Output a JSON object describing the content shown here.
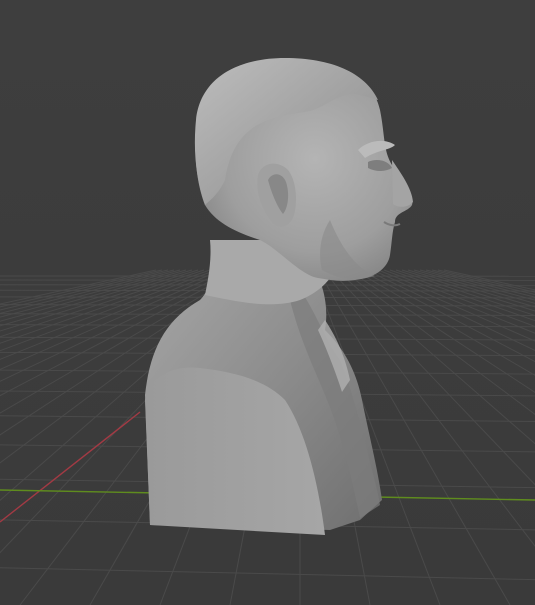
{
  "viewport": {
    "background_color": "#3d3d3d",
    "grid_color": "#4a4a4a",
    "x_axis_color": "#a23a44",
    "y_axis_color": "#5f8c1e",
    "model_color": "#9c9c9c",
    "object": "bust"
  }
}
